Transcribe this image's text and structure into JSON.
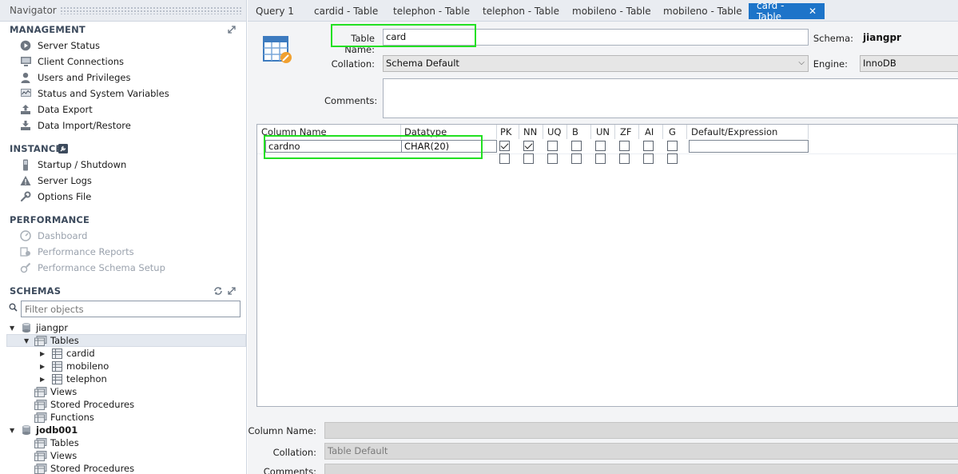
{
  "navigator": {
    "title": "Navigator",
    "management": {
      "heading": "MANAGEMENT",
      "items": [
        "Server Status",
        "Client Connections",
        "Users and Privileges",
        "Status and System Variables",
        "Data Export",
        "Data Import/Restore"
      ]
    },
    "instance": {
      "heading": "INSTANCE",
      "items": [
        "Startup / Shutdown",
        "Server Logs",
        "Options File"
      ]
    },
    "performance": {
      "heading": "PERFORMANCE",
      "items": [
        "Dashboard",
        "Performance Reports",
        "Performance Schema Setup"
      ]
    },
    "schemas": {
      "heading": "SCHEMAS",
      "filter_placeholder": "Filter objects",
      "tree": [
        {
          "label": "jiangpr"
        },
        {
          "label": "Tables"
        },
        {
          "label": "cardid"
        },
        {
          "label": "mobileno"
        },
        {
          "label": "telephon"
        },
        {
          "label": "Views"
        },
        {
          "label": "Stored Procedures"
        },
        {
          "label": "Functions"
        },
        {
          "label": "jodb001"
        },
        {
          "label": "Tables"
        },
        {
          "label": "Views"
        },
        {
          "label": "Stored Procedures"
        }
      ]
    }
  },
  "tabs": [
    "Query 1",
    "cardid - Table",
    "telephon - Table",
    "telephon - Table",
    "mobileno - Table",
    "mobileno - Table",
    "card - Table"
  ],
  "tab_close": "✕",
  "editor": {
    "table_name_label": "Table Name:",
    "table_name_value": "card",
    "schema_label": "Schema:",
    "schema_value": "jiangpr",
    "collation_label": "Collation:",
    "collation_value": "Schema Default",
    "engine_label": "Engine:",
    "engine_value": "InnoDB",
    "comments_label": "Comments:",
    "comments_value": ""
  },
  "grid": {
    "headers": [
      "Column Name",
      "Datatype",
      "PK",
      "NN",
      "UQ",
      "B",
      "UN",
      "ZF",
      "AI",
      "G",
      "Default/Expression"
    ],
    "rows": [
      {
        "name": "cardno",
        "datatype": "CHAR(20)",
        "flags": [
          true,
          true,
          false,
          false,
          false,
          false,
          false,
          false
        ],
        "default": ""
      },
      {
        "name": "",
        "datatype": "",
        "flags": [
          false,
          false,
          false,
          false,
          false,
          false,
          false,
          false
        ],
        "default": ""
      }
    ]
  },
  "details": {
    "column_name_label": "Column Name:",
    "collation_label": "Collation:",
    "collation_value": "Table Default",
    "comments_label": "Comments:"
  },
  "colors": {
    "active_tab": "#1d74c9",
    "highlight": "#22e022"
  }
}
